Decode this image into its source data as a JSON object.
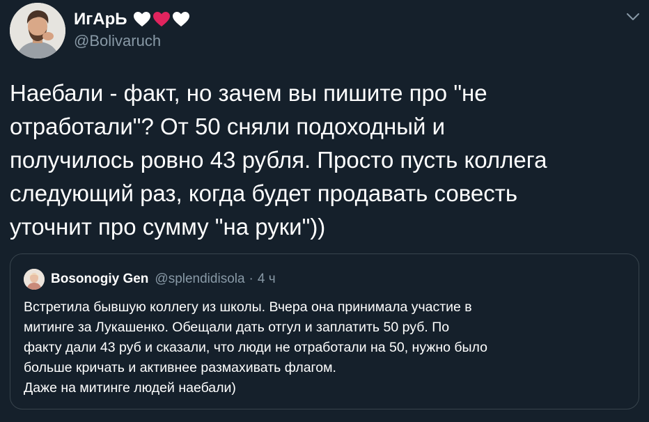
{
  "tweet": {
    "author": {
      "name": "ИгАрЬ",
      "handle": "@Bolivaruch",
      "emoji_hearts": [
        "white-heart",
        "red-heart",
        "white-heart"
      ]
    },
    "text": "Наебали - факт, но зачем вы пишите про \"не\nотработали\"? От 50 сняли подоходный и\nполучилось ровно 43 рубля. Просто пусть коллега\nследующий раз, когда будет продавать совесть\nуточнит про сумму \"на руки\"))",
    "menu_icon": "chevron-down-icon"
  },
  "quoted_tweet": {
    "author": {
      "name": "Bosonogiy Gen",
      "handle": "@splendidisola",
      "separator": "·",
      "time": "4 ч"
    },
    "text": "Встретила бывшую коллегу из школы. Вчера она принимала участие в\nмитинге за Лукашенко. Обещали дать отгул и заплатить 50 руб. По\nфакту дали 43 руб и сказали, что люди не отработали на 50, нужно было\nбольше кричать и активнее размахивать флагом.\nДаже на митинге людей наебали)"
  },
  "colors": {
    "background": "#15202b",
    "text_primary": "#ffffff",
    "text_secondary": "#8899a6",
    "border": "#38444d",
    "heart_red": "#e0245e"
  }
}
